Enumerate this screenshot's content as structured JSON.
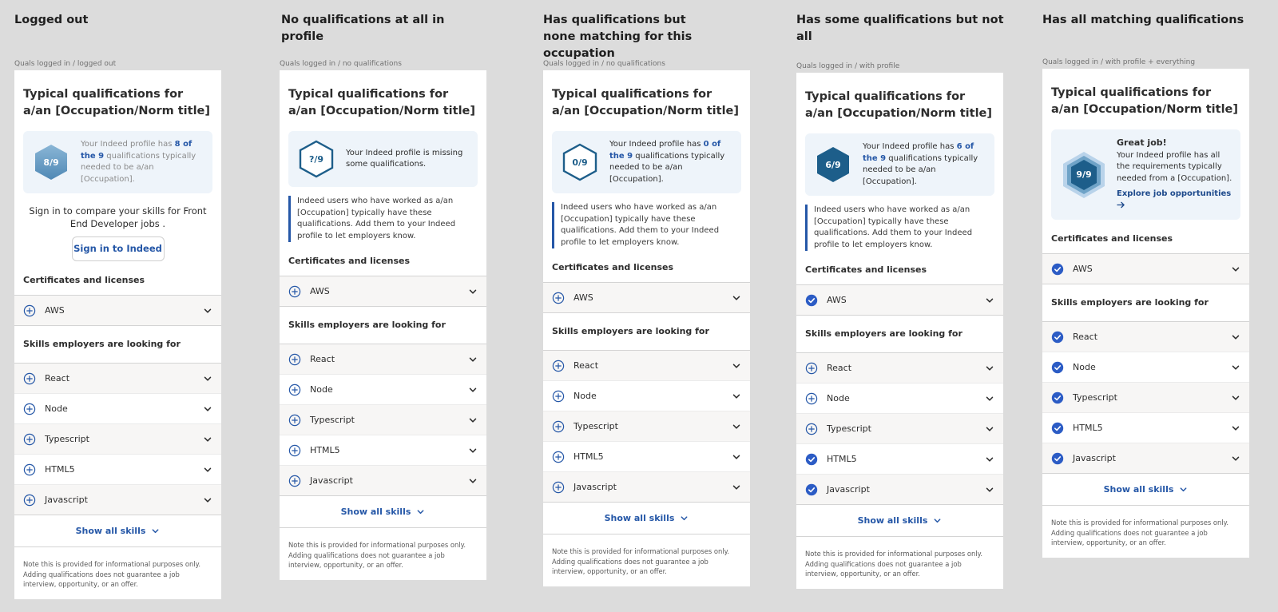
{
  "columns": [
    {
      "heading": "Logged out",
      "caption": "Quals logged in / logged out",
      "card_title": "Typical qualifications for a/an [Occupation/Norm title]",
      "badge": "8/9",
      "status_pre": "Your Indeed profile has ",
      "status_highlight": "8 of the 9",
      "status_post": " qualifications typically needed to be a/an [Occupation].",
      "signin_text": "Sign in to compare your skills for Front End Developer jobs .",
      "signin_button": "Sign in to Indeed",
      "certs_heading": "Certificates and licenses",
      "certs": [
        {
          "label": "AWS"
        }
      ],
      "skills_heading": "Skills employers are looking for",
      "skills": [
        {
          "label": "React"
        },
        {
          "label": "Node"
        },
        {
          "label": "Typescript"
        },
        {
          "label": "HTML5"
        },
        {
          "label": "Javascript"
        }
      ],
      "show_all": "Show all skills",
      "disclaimer": "Note this is provided for informational purposes only. Adding qualifications does not guarantee a job interview, opportunity, or an offer."
    },
    {
      "heading": "No qualifications at all in profile",
      "caption": "Quals logged in / no qualifications",
      "card_title": "Typical qualifications for a/an [Occupation/Norm title]",
      "badge": "?/9",
      "status_text": "Your Indeed profile is missing some qualifications.",
      "info_note": "Indeed users who have worked as a/an [Occupation] typically have these qualifications. Add them to your Indeed profile to let employers know.",
      "certs_heading": "Certificates and licenses",
      "certs": [
        {
          "label": "AWS"
        }
      ],
      "skills_heading": "Skills employers are looking for",
      "skills": [
        {
          "label": "React"
        },
        {
          "label": "Node"
        },
        {
          "label": "Typescript"
        },
        {
          "label": "HTML5"
        },
        {
          "label": "Javascript"
        }
      ],
      "show_all": "Show all skills",
      "disclaimer": "Note this is provided for informational purposes only. Adding qualifications does not guarantee a job interview, opportunity, or an offer."
    },
    {
      "heading": "Has qualifications but none matching for this occupation",
      "caption": "Quals logged in / no qualifications",
      "card_title": "Typical qualifications for a/an [Occupation/Norm title]",
      "badge": "0/9",
      "status_pre": "Your Indeed profile has ",
      "status_highlight": "0 of the 9",
      "status_post": " qualifications typically needed to be a/an [Occupation].",
      "info_note": "Indeed users who have worked as a/an [Occupation] typically have these qualifications. Add them to your Indeed profile to let employers know.",
      "certs_heading": "Certificates and licenses",
      "certs": [
        {
          "label": "AWS"
        }
      ],
      "skills_heading": "Skills employers are looking for",
      "skills": [
        {
          "label": "React"
        },
        {
          "label": "Node"
        },
        {
          "label": "Typescript"
        },
        {
          "label": "HTML5"
        },
        {
          "label": "Javascript"
        }
      ],
      "show_all": "Show all skills",
      "disclaimer": "Note this is provided for informational purposes only. Adding qualifications does not guarantee a job interview, opportunity, or an offer."
    },
    {
      "heading": "Has some qualifications but not all",
      "caption": "Quals logged in / with profile",
      "card_title": "Typical qualifications for a/an [Occupation/Norm title]",
      "badge": "6/9",
      "status_pre": "Your Indeed profile has ",
      "status_highlight": "6 of the 9",
      "status_post": " qualifications typically needed to be a/an [Occupation].",
      "info_note": "Indeed users who have worked as a/an [Occupation] typically have these qualifications. Add them to your Indeed profile to let employers know.",
      "certs_heading": "Certificates and licenses",
      "certs": [
        {
          "label": "AWS",
          "checked": true
        }
      ],
      "skills_heading": "Skills employers are looking for",
      "skills": [
        {
          "label": "React"
        },
        {
          "label": "Node"
        },
        {
          "label": "Typescript"
        },
        {
          "label": "HTML5",
          "checked": true
        },
        {
          "label": "Javascript",
          "checked": true
        }
      ],
      "show_all": "Show all skills",
      "disclaimer": "Note this is provided for informational purposes only. Adding qualifications does not guarantee a job interview, opportunity, or an offer."
    },
    {
      "heading": "Has all matching qualifications",
      "caption": "Quals logged in / with profile + everything",
      "card_title": "Typical qualifications for a/an [Occupation/Norm title]",
      "badge": "9/9",
      "status_title": "Great job!",
      "status_text": "Your Indeed profile has all the requirements typically needed from a [Occupation].",
      "explore_link": "Explore job opportunities",
      "certs_heading": "Certificates and licenses",
      "certs": [
        {
          "label": "AWS",
          "checked": true
        }
      ],
      "skills_heading": "Skills employers are looking for",
      "skills": [
        {
          "label": "React",
          "checked": true
        },
        {
          "label": "Node",
          "checked": true
        },
        {
          "label": "Typescript",
          "checked": true
        },
        {
          "label": "HTML5",
          "checked": true
        },
        {
          "label": "Javascript",
          "checked": true
        }
      ],
      "show_all": "Show all skills",
      "disclaimer": "Note this is provided for informational purposes only. Adding qualifications does not guarantee a job interview, opportunity, or an offer."
    }
  ],
  "colors": {
    "accent": "#2557a7",
    "hex_dark": "#1d5e8a",
    "hex_light": "#6fa3c7",
    "check": "#2c5cc5"
  },
  "icons": {
    "add": "plus-circle-icon",
    "checked": "check-circle-icon",
    "expand": "chevron-down-icon",
    "arrow": "arrow-right-icon"
  }
}
